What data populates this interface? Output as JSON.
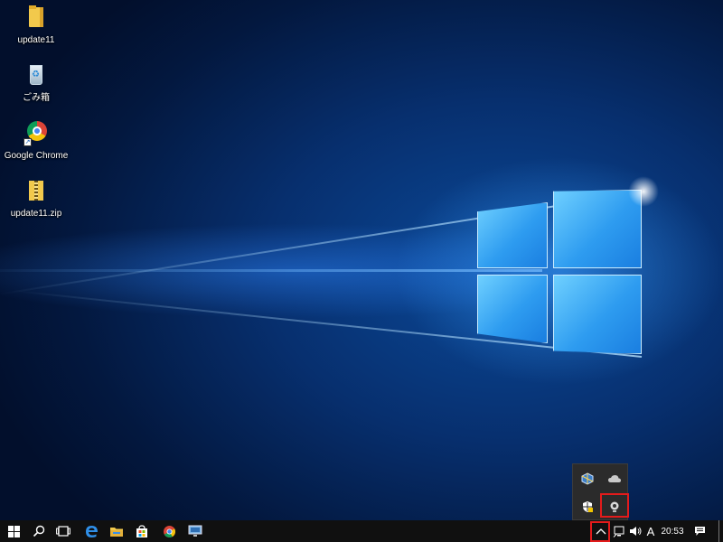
{
  "desktop": {
    "icons": [
      {
        "label": "update11",
        "kind": "folder-icon"
      },
      {
        "label": "ごみ箱",
        "kind": "recycle-bin-icon"
      },
      {
        "label": "Google Chrome",
        "kind": "chrome-icon"
      },
      {
        "label": "update11.zip",
        "kind": "zip-folder-icon"
      }
    ]
  },
  "taskbar": {
    "pinned": [
      "start-icon",
      "search-icon",
      "task-view-icon",
      "edge-icon",
      "file-explorer-icon",
      "store-icon",
      "chrome-icon",
      "remote-desktop-icon"
    ],
    "tray": {
      "overflow_icons": [
        "virtualbox-icon",
        "onedrive-icon",
        "windows-defender-icon",
        "webcam-icon"
      ],
      "ime_label": "A",
      "clock": "20:53"
    }
  },
  "highlights": {
    "color": "#e41b1b",
    "targets": [
      "show-hidden-icons-button",
      "webcam-icon"
    ]
  }
}
